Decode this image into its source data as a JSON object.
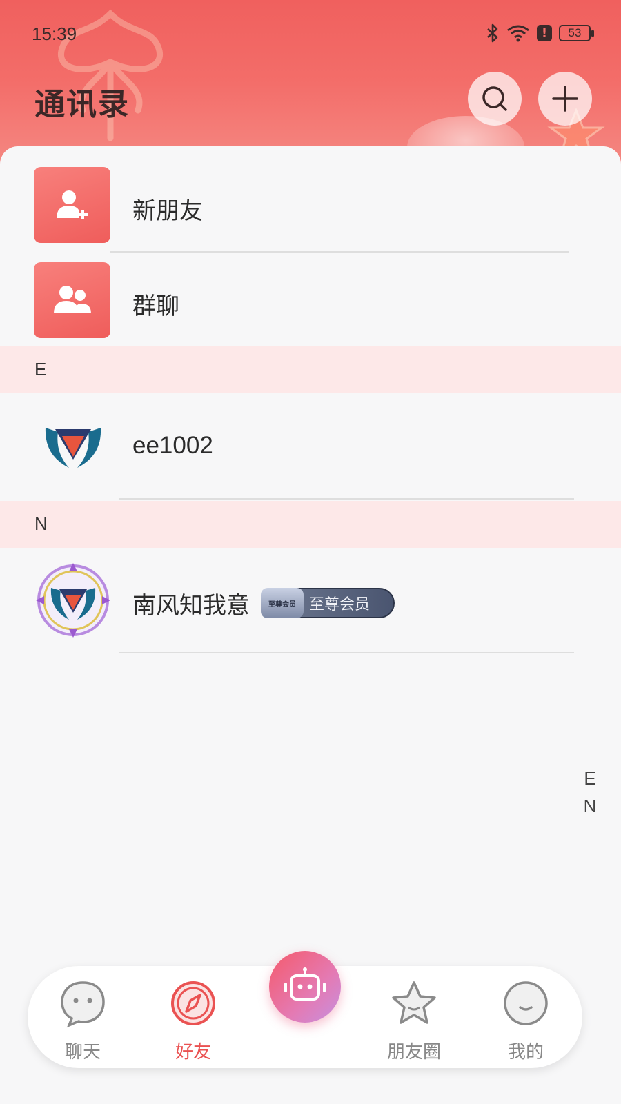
{
  "status_bar": {
    "time": "15:39",
    "battery": "53",
    "alert": "!"
  },
  "header": {
    "title": "通讯录"
  },
  "functions": [
    {
      "label": "新朋友",
      "icon": "add-friend-icon"
    },
    {
      "label": "群聊",
      "icon": "group-chat-icon"
    }
  ],
  "sections": [
    {
      "letter": "E",
      "contacts": [
        {
          "name": "ee1002",
          "avatar": "shield-logo-avatar"
        }
      ]
    },
    {
      "letter": "N",
      "contacts": [
        {
          "name": "南风知我意",
          "avatar": "framed-shield-logo-avatar",
          "badge": {
            "emblem": "至尊会员",
            "label": "至尊会员"
          }
        }
      ]
    }
  ],
  "index_bar": [
    "E",
    "N"
  ],
  "bottom_nav": [
    {
      "label": "聊天",
      "icon": "chat-bubble-icon",
      "active": false
    },
    {
      "label": "好友",
      "icon": "compass-icon",
      "active": true
    },
    {
      "label": "",
      "icon": "robot-icon",
      "active": false
    },
    {
      "label": "朋友圈",
      "icon": "star-icon",
      "active": false
    },
    {
      "label": "我的",
      "icon": "smile-face-icon",
      "active": false
    }
  ],
  "colors": {
    "accent": "#ea5252",
    "header_start": "#f0605e",
    "section_bg": "#fde8e8",
    "badge": "#4a5570"
  }
}
